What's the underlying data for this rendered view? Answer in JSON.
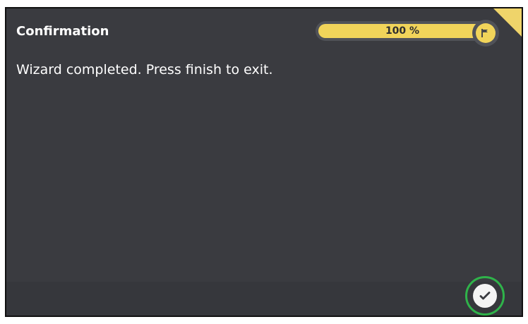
{
  "dialog": {
    "title": "Confirmation",
    "message": "Wizard completed. Press finish to exit."
  },
  "progress": {
    "label": "100 %",
    "value": 100,
    "icon": "flag-icon",
    "fill_color": "#f1d45a"
  },
  "finish": {
    "icon": "checkmark-icon",
    "ring_color": "#2fb34a"
  },
  "colors": {
    "panel": "#3a3b40",
    "accent": "#efd46a"
  }
}
